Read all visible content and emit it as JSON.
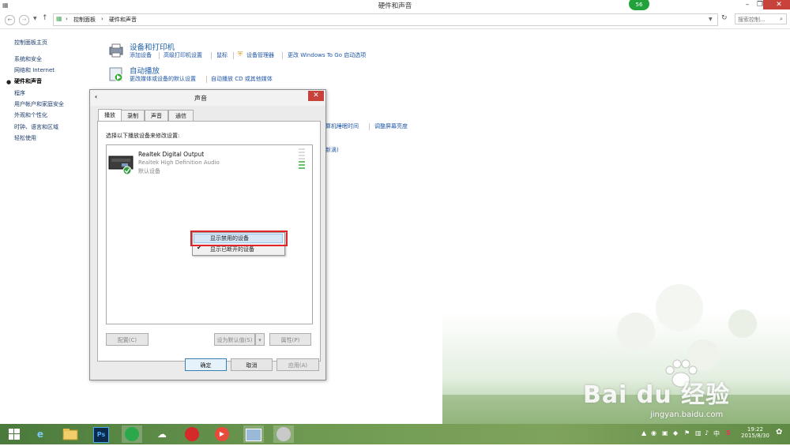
{
  "window": {
    "title": "硬件和声音",
    "badge": "56"
  },
  "address": {
    "crumbs": [
      "控制面板",
      "硬件和声音"
    ],
    "search_placeholder": "搜索控制..."
  },
  "sidebar": {
    "items": [
      "控制面板主页",
      "系统和安全",
      "网络和 Internet",
      "硬件和声音",
      "程序",
      "用户帐户和家庭安全",
      "外观和个性化",
      "时钟、语言和区域",
      "轻松使用"
    ]
  },
  "content": {
    "devices": {
      "title": "设备和打印机",
      "links": [
        "添加设备",
        "高级打印机设置",
        "鼠标",
        "设备管理器",
        "更改 Windows To Go 启动选项"
      ]
    },
    "autoplay": {
      "title": "自动播放",
      "links": [
        "更改媒体或设备的默认设置",
        "自动播放 CD 或其他媒体"
      ]
    },
    "power_partial": [
      "算机睡眠时间",
      "调整屏幕亮度"
    ],
    "partial_text": "新滴)"
  },
  "dialog": {
    "title": "声音",
    "tabs": [
      "播放",
      "录制",
      "声音",
      "通信"
    ],
    "instruction": "选择以下播放设备来修改设置:",
    "device": {
      "name": "Realtek Digital Output",
      "driver": "Realtek High Definition Audio",
      "status": "默认设备"
    },
    "buttons": {
      "configure": "配置(C)",
      "set_default": "设为默认值(S)",
      "properties": "属性(P)",
      "ok": "确定",
      "cancel": "取消",
      "apply": "应用(A)"
    },
    "context_menu": [
      "显示禁用的设备",
      "显示已断开的设备"
    ]
  },
  "watermark": {
    "brand": "Bai du 经验",
    "url": "jingyan.baidu.com"
  },
  "taskbar": {
    "clock_time": "19:22",
    "clock_date": "2015/8/30",
    "ime": "中",
    "tray_s": "S"
  },
  "colors": {
    "link": "#1f56a8",
    "close_button": "#c7423b",
    "highlight_box": "#e0242a",
    "taskbar": "#6f9a52"
  }
}
